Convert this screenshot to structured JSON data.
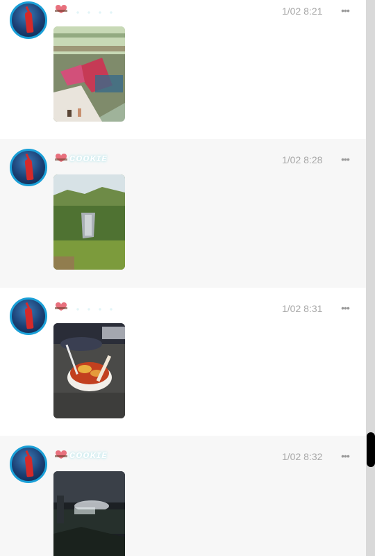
{
  "posts": [
    {
      "time": "1/02 8:21",
      "nickname": "",
      "photo": "mall-interior-photo"
    },
    {
      "time": "1/02 8:28",
      "nickname": "ᴄᴏᴏᴋɪᴇ",
      "photo": "garden-waterfall-photo"
    },
    {
      "time": "1/02 8:31",
      "nickname": "",
      "photo": "food-bowl-photo"
    },
    {
      "time": "1/02 8:32",
      "nickname": "ᴄᴏᴏᴋɪᴇ",
      "photo": "night-scene-photo"
    }
  ],
  "icons": {
    "more": "more-dots-icon",
    "badge": "heart-badge-icon"
  },
  "colors": {
    "avatar_ring": "#1aa0d8",
    "time_text": "#a8a8a8",
    "alt_row_bg": "#f7f7f7",
    "scroll_thumb": "#000000"
  }
}
